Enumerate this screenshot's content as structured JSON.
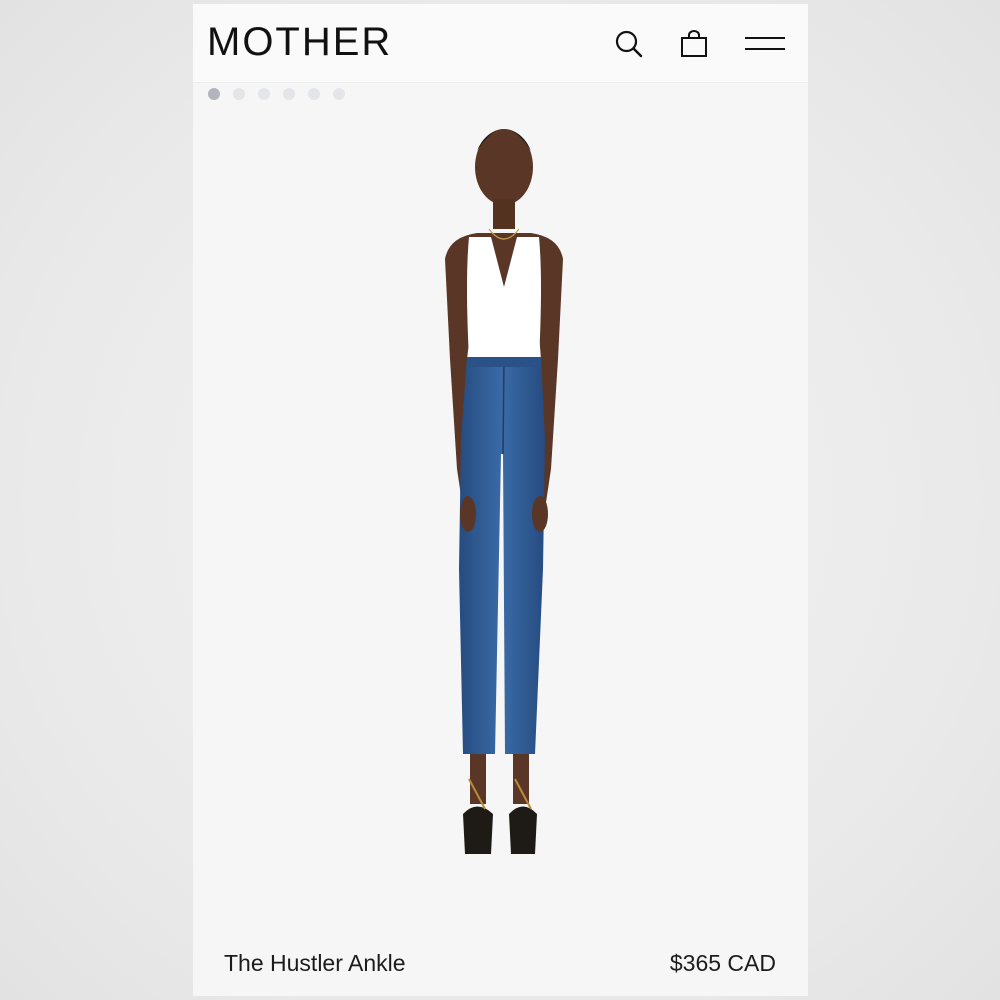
{
  "header": {
    "logo": "MOTHER",
    "icons": [
      "search-icon",
      "shopping-bag-icon",
      "menu-icon"
    ]
  },
  "carousel": {
    "total_images": 6,
    "active_index": 0
  },
  "product": {
    "name": "The Hustler Ankle",
    "price": "$365 CAD"
  },
  "colors": {
    "denim": "#2f5a92",
    "background": "#f6f6f6"
  }
}
